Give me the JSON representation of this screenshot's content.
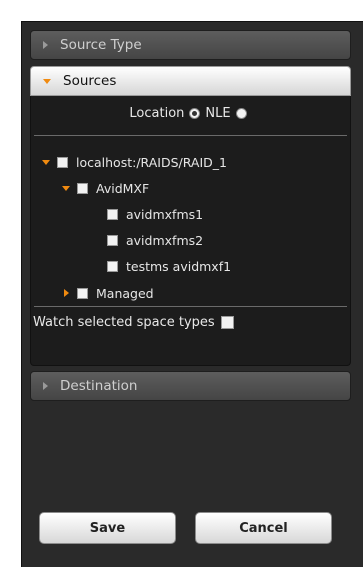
{
  "sections": {
    "source_type": {
      "label": "Source Type",
      "expanded": false
    },
    "sources": {
      "label": "Sources",
      "expanded": true,
      "location": {
        "label": "Location",
        "selected": "Location",
        "nle_label": "NLE"
      },
      "tree": [
        {
          "label": "localhost:/RAIDS/RAID_1",
          "level": 0,
          "toggle": "expanded"
        },
        {
          "label": "AvidMXF",
          "level": 1,
          "toggle": "expanded"
        },
        {
          "label": "avidmxfms1",
          "level": 2,
          "toggle": "none"
        },
        {
          "label": "avidmxfms2",
          "level": 2,
          "toggle": "none"
        },
        {
          "label": "testms avidmxf1",
          "level": 2,
          "toggle": "none"
        },
        {
          "label": "Managed",
          "level": 1,
          "toggle": "collapsed"
        }
      ],
      "watch_label": "Watch selected space types"
    },
    "destination": {
      "label": "Destination",
      "expanded": false
    }
  },
  "buttons": {
    "save": "Save",
    "cancel": "Cancel"
  },
  "colors": {
    "accent": "#f08a10",
    "panel_bg": "#2a2a2a",
    "body_bg": "#1c1c1c"
  }
}
